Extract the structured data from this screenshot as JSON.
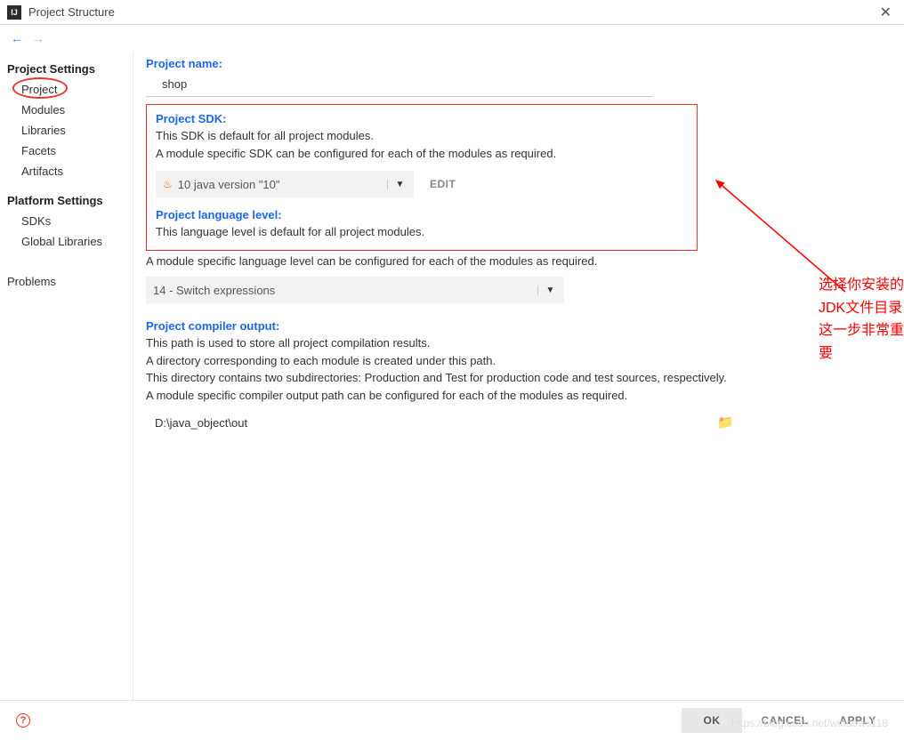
{
  "titlebar": {
    "app_icon_text": "IJ",
    "title": "Project Structure"
  },
  "sidebar": {
    "heading_project_settings": "Project Settings",
    "heading_platform_settings": "Platform Settings",
    "items_project": [
      "Project",
      "Modules",
      "Libraries",
      "Facets",
      "Artifacts"
    ],
    "items_platform": [
      "SDKs",
      "Global Libraries"
    ],
    "item_problems": "Problems"
  },
  "content": {
    "project_name_label": "Project name:",
    "project_name_value": "shop",
    "project_sdk_label": "Project SDK:",
    "sdk_desc1": "This SDK is default for all project modules.",
    "sdk_desc2": "A module specific SDK can be configured for each of the modules as required.",
    "sdk_value": "10 java version \"10\"",
    "edit_label": "EDIT",
    "lang_level_label": "Project language level:",
    "lang_level_desc1": "This language level is default for all project modules.",
    "lang_level_desc2": "A module specific language level can be configured for each of the modules as required.",
    "lang_level_value": "14 - Switch expressions",
    "compiler_output_label": "Project compiler output:",
    "compiler_desc1": "This path is used to store all project compilation results.",
    "compiler_desc2": "A directory corresponding to each module is created under this path.",
    "compiler_desc3": "This directory contains two subdirectories: Production and Test for production code and test sources, respectively.",
    "compiler_desc4": "A module specific compiler output path can be configured for each of the modules as required.",
    "compiler_output_value": "D:\\java_object\\out"
  },
  "annotation": {
    "line1": "选择你安装的JDK文件目录",
    "line2": "这一步非常重要"
  },
  "buttons": {
    "ok": "OK",
    "cancel": "CANCEL",
    "apply": "APPLY"
  },
  "watermark": "https://blog.csdn.net/windows118"
}
